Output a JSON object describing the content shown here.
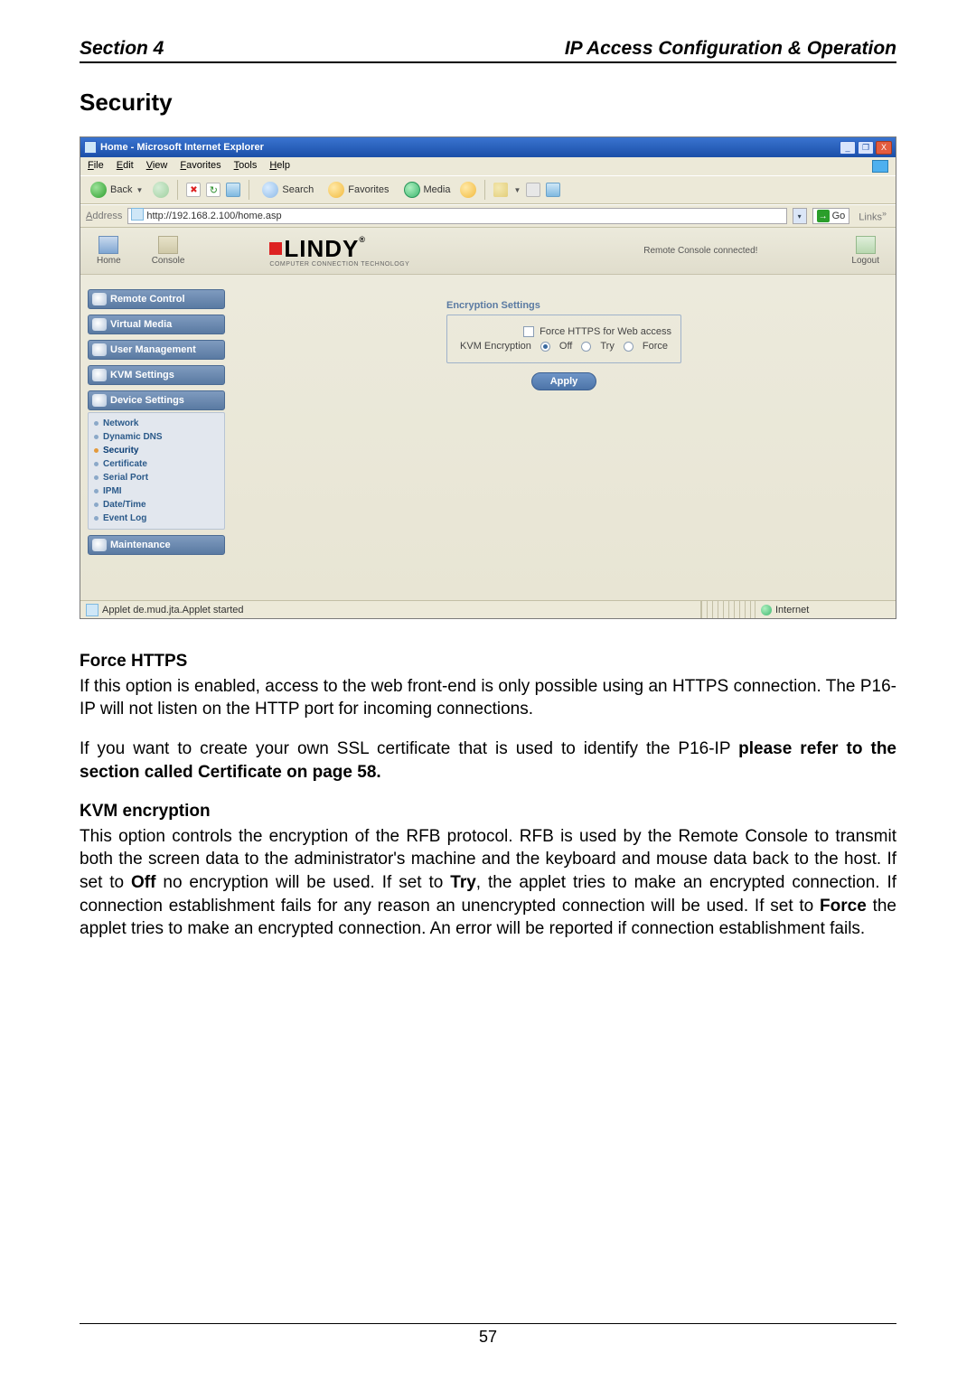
{
  "header": {
    "left": "Section 4",
    "right": "IP Access Configuration & Operation"
  },
  "title_main": "Security",
  "shot": {
    "titlebar": "Home - Microsoft Internet Explorer",
    "winbtns": {
      "min": "_",
      "max": "❐",
      "close": "X"
    },
    "menu": {
      "file": "File",
      "edit": "Edit",
      "view": "View",
      "favorites": "Favorites",
      "tools": "Tools",
      "help": "Help"
    },
    "toolbar": {
      "back": "Back",
      "search": "Search",
      "favorites": "Favorites",
      "media": "Media",
      "stop": "✖",
      "refresh": "↻"
    },
    "address": {
      "label": "Address",
      "value": "http://192.168.2.100/home.asp",
      "go": "Go",
      "links": "Links"
    },
    "appbar": {
      "home": "Home",
      "console": "Console",
      "logout": "Logout",
      "brand_main": "LINDY",
      "brand_r": "®",
      "brand_sub": "COMPUTER CONNECTION TECHNOLOGY",
      "remote_status": "Remote Console connected!"
    },
    "nav": {
      "remote_control": "Remote Control",
      "virtual_media": "Virtual Media",
      "user_management": "User Management",
      "kvm_settings": "KVM Settings",
      "device_settings": "Device Settings",
      "sub": {
        "network": "Network",
        "dynamic_dns": "Dynamic DNS",
        "security": "Security",
        "certificate": "Certificate",
        "serial_port": "Serial Port",
        "ipmi": "IPMI",
        "date_time": "Date/Time",
        "event_log": "Event Log"
      },
      "maintenance": "Maintenance"
    },
    "panel": {
      "legend": "Encryption Settings",
      "force_https_label": "Force HTTPS for Web access",
      "kvm_enc_label": "KVM Encryption",
      "opt_off": "Off",
      "opt_try": "Try",
      "opt_force": "Force",
      "apply": "Apply"
    },
    "status": {
      "left": "Applet de.mud.jta.Applet started",
      "zone": "Internet"
    }
  },
  "doc": {
    "h_force_https": "Force HTTPS",
    "p_force_https": "If this option is enabled, access to the web front-end is only possible using an HTTPS connection. The P16-IP will not listen on the HTTP port for incoming connections.",
    "p_ssl_pre": "If you want to create your own SSL certificate that is used to identify the P16-IP ",
    "p_ssl_bold": "please refer to the section called Certificate on page 58.",
    "h_kvm": "KVM encryption",
    "p_kvm_1": "This option controls the encryption of the RFB protocol. RFB is used by the Remote Console to transmit both the screen data to the administrator's machine and the keyboard and mouse data back to the host. If set to ",
    "p_kvm_off": "Off",
    "p_kvm_2": " no encryption will be used. If set to ",
    "p_kvm_try": "Try",
    "p_kvm_3": ", the applet tries to make an encrypted connection. If connection establishment fails for any reason an unencrypted connection will be used. If set to ",
    "p_kvm_force": "Force",
    "p_kvm_4": " the applet tries to make an encrypted connection. An error will be reported if connection establishment fails."
  },
  "pagenum": "57"
}
